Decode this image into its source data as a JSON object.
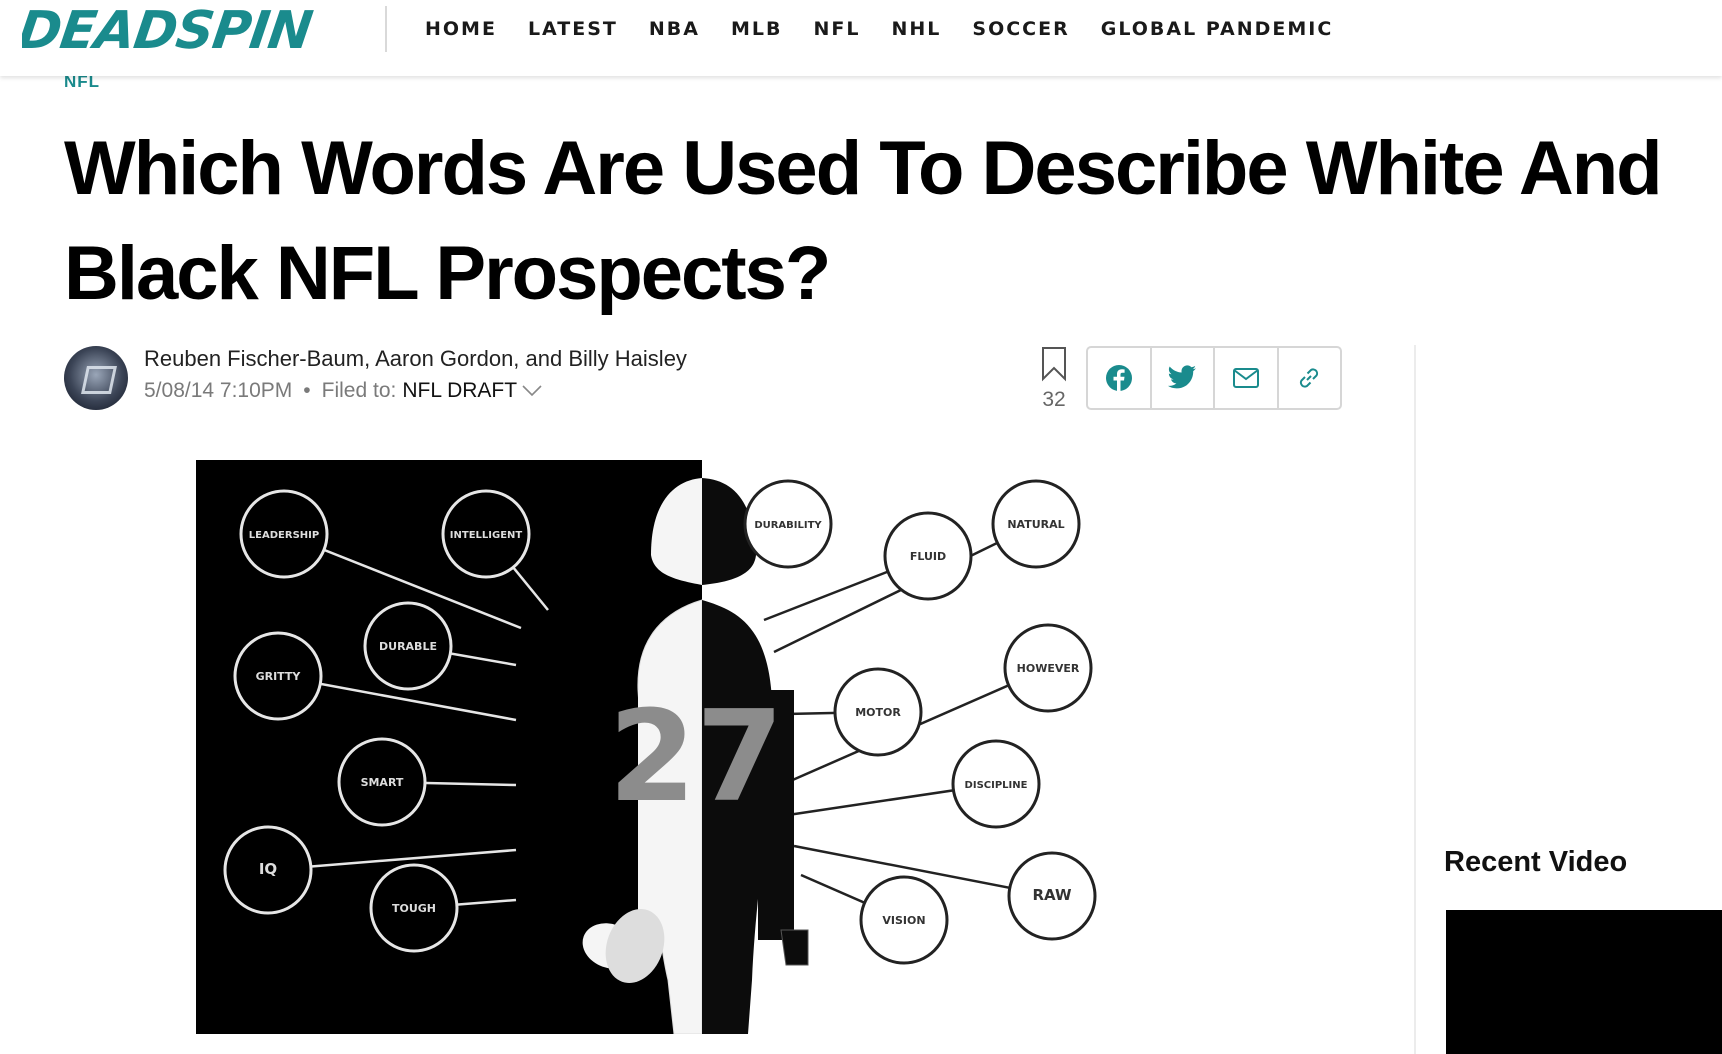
{
  "site": {
    "logo_text": "DEADSPIN",
    "nav": [
      "HOME",
      "LATEST",
      "NBA",
      "MLB",
      "NFL",
      "NHL",
      "SOCCER",
      "GLOBAL PANDEMIC"
    ]
  },
  "article": {
    "kicker": "NFL",
    "headline": "Which Words Are Used To Describe White And Black NFL Prospects?",
    "authors": "Reuben Fischer-Baum, Aaron Gordon, and Billy Haisley",
    "timestamp": "5/08/14 7:10PM",
    "separator": "•",
    "filed_label": "Filed to:",
    "filed_category": "NFL DRAFT",
    "bookmark_count": "32"
  },
  "hero_image": {
    "jersey_number": "27",
    "white_words": [
      "LEADERSHIP",
      "INTELLIGENT",
      "DURABLE",
      "GRITTY",
      "SMART",
      "IQ",
      "TOUGH"
    ],
    "black_words": [
      "DURABILITY",
      "FLUID",
      "NATURAL",
      "HOWEVER",
      "MOTOR",
      "DISCIPLINE",
      "RAW",
      "VISION"
    ]
  },
  "sidebar": {
    "recent_video_label": "Recent Video"
  },
  "colors": {
    "brand_teal": "#1a8b8d",
    "text": "#000000",
    "meta_gray": "#7a7a7a"
  },
  "icons": [
    "bookmark-icon",
    "facebook-icon",
    "twitter-icon",
    "email-icon",
    "link-icon",
    "chevron-down-icon"
  ]
}
